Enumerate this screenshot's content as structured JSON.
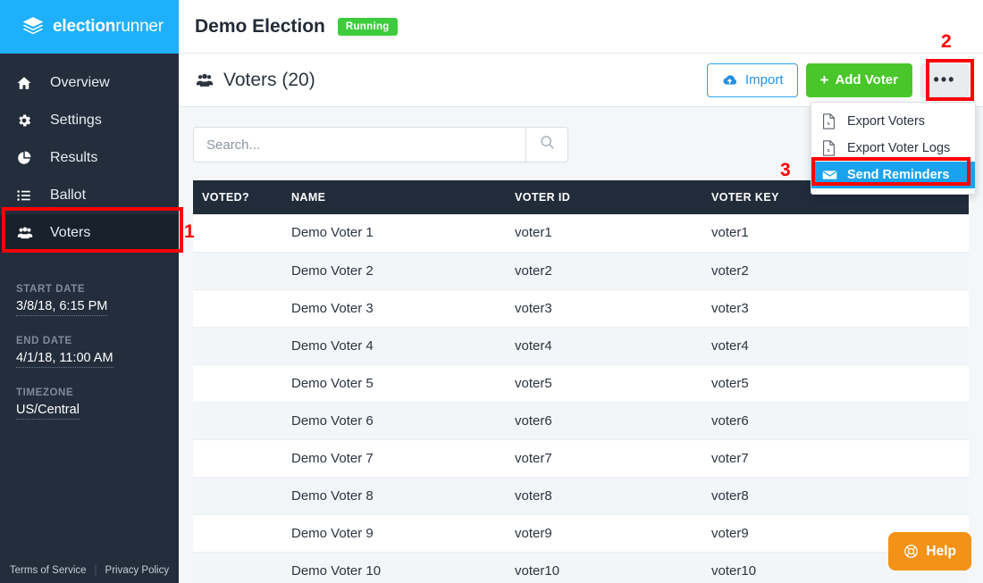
{
  "brand": {
    "name_bold": "election",
    "name_light": "runner",
    "icon": "layers-stack-icon",
    "bg": "#1eb0fa"
  },
  "sidebar": {
    "items": [
      {
        "label": "Overview",
        "icon": "home-icon",
        "active": false
      },
      {
        "label": "Settings",
        "icon": "gear-icon",
        "active": false
      },
      {
        "label": "Results",
        "icon": "pie-chart-icon",
        "active": false
      },
      {
        "label": "Ballot",
        "icon": "list-icon",
        "active": false
      },
      {
        "label": "Voters",
        "icon": "users-icon",
        "active": true
      }
    ],
    "meta": [
      {
        "key": "START DATE",
        "value": "3/8/18, 6:15 PM"
      },
      {
        "key": "END DATE",
        "value": "4/1/18, 11:00 AM"
      },
      {
        "key": "TIMEZONE",
        "value": "US/Central"
      }
    ],
    "footer": {
      "terms": "Terms of Service",
      "privacy": "Privacy Policy"
    }
  },
  "header": {
    "election_title": "Demo Election",
    "status_badge": "Running",
    "status_color": "#3dcc3d"
  },
  "page": {
    "title": "Voters (20)",
    "title_icon": "users-icon",
    "actions": {
      "import_label": "Import",
      "import_icon": "cloud-upload-icon",
      "add_voter_label": "Add Voter",
      "add_voter_plus": "+",
      "more_label": "•••"
    }
  },
  "dropdown": {
    "open": true,
    "items": [
      {
        "label": "Export Voters",
        "icon": "file-excel-icon",
        "highlighted": false
      },
      {
        "label": "Export Voter Logs",
        "icon": "file-excel-icon",
        "highlighted": false
      },
      {
        "label": "Send Reminders",
        "icon": "envelope-icon",
        "highlighted": true
      }
    ],
    "highlight_color": "#19a3ef"
  },
  "search": {
    "placeholder": "Search...",
    "value": "",
    "button_icon": "search-icon"
  },
  "table": {
    "columns": [
      "VOTED?",
      "NAME",
      "VOTER ID",
      "VOTER KEY"
    ],
    "rows": [
      {
        "voted": "",
        "name": "Demo Voter 1",
        "voter_id": "voter1",
        "voter_key": "voter1"
      },
      {
        "voted": "",
        "name": "Demo Voter 2",
        "voter_id": "voter2",
        "voter_key": "voter2"
      },
      {
        "voted": "",
        "name": "Demo Voter 3",
        "voter_id": "voter3",
        "voter_key": "voter3"
      },
      {
        "voted": "",
        "name": "Demo Voter 4",
        "voter_id": "voter4",
        "voter_key": "voter4"
      },
      {
        "voted": "",
        "name": "Demo Voter 5",
        "voter_id": "voter5",
        "voter_key": "voter5"
      },
      {
        "voted": "",
        "name": "Demo Voter 6",
        "voter_id": "voter6",
        "voter_key": "voter6"
      },
      {
        "voted": "",
        "name": "Demo Voter 7",
        "voter_id": "voter7",
        "voter_key": "voter7"
      },
      {
        "voted": "",
        "name": "Demo Voter 8",
        "voter_id": "voter8",
        "voter_key": "voter8"
      },
      {
        "voted": "",
        "name": "Demo Voter 9",
        "voter_id": "voter9",
        "voter_key": "voter9"
      },
      {
        "voted": "",
        "name": "Demo Voter 10",
        "voter_id": "voter10",
        "voter_key": "voter10"
      }
    ]
  },
  "help": {
    "label": "Help",
    "icon": "life-ring-icon",
    "color": "#f39216"
  },
  "annotations": {
    "one": "1",
    "two": "2",
    "three": "3",
    "color": "#ff0000"
  }
}
